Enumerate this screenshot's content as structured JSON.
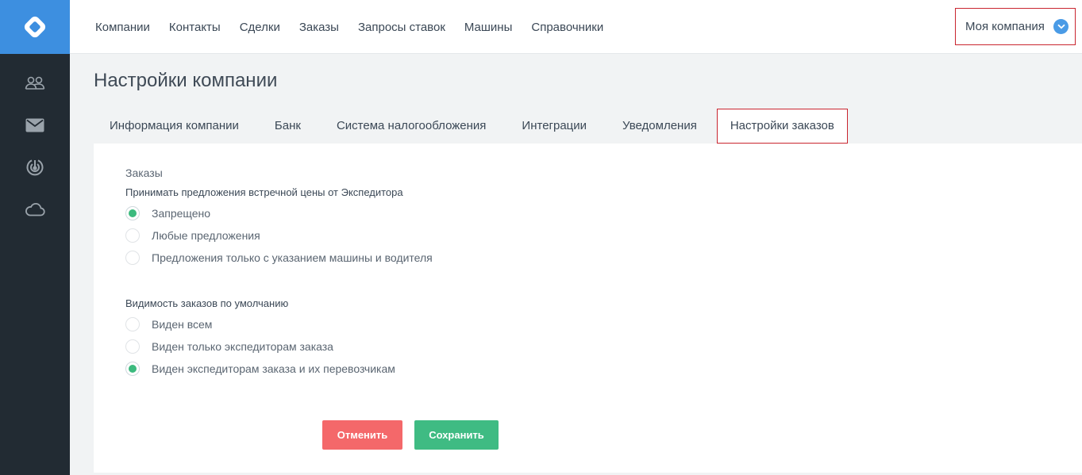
{
  "sidebar": {
    "logo_icon": "diamond-logo",
    "items": [
      {
        "icon": "users-icon"
      },
      {
        "icon": "mail-icon"
      },
      {
        "icon": "radar-icon"
      },
      {
        "icon": "cloud-icon"
      }
    ]
  },
  "nav": {
    "items": [
      "Компании",
      "Контакты",
      "Сделки",
      "Заказы",
      "Запросы ставок",
      "Машины",
      "Справочники"
    ]
  },
  "company_menu": {
    "label": "Моя компания",
    "icon": "chevron-down-icon",
    "accent": "#4a9be6"
  },
  "page": {
    "title": "Настройки компании"
  },
  "tabs": [
    {
      "label": "Информация компании"
    },
    {
      "label": "Банк"
    },
    {
      "label": "Система налогообложения"
    },
    {
      "label": "Интеграции"
    },
    {
      "label": "Уведомления"
    },
    {
      "label": "Настройки заказов",
      "active": true
    }
  ],
  "orders": {
    "section_title": "Заказы",
    "counter_offers": {
      "question": "Принимать предложения встречной цены от Экспедитора",
      "options": [
        {
          "label": "Запрещено",
          "selected": true
        },
        {
          "label": "Любые предложения",
          "selected": false
        },
        {
          "label": "Предложения только с указанием машины и водителя",
          "selected": false
        }
      ]
    },
    "visibility": {
      "question": "Видимость заказов по умолчанию",
      "options": [
        {
          "label": "Виден всем",
          "selected": false
        },
        {
          "label": "Виден только экспедиторам заказа",
          "selected": false
        },
        {
          "label": "Виден экспедиторам заказа и их перевозчикам",
          "selected": true
        }
      ]
    }
  },
  "actions": {
    "cancel_label": "Отменить",
    "save_label": "Сохранить",
    "cancel_color": "#f4686a",
    "save_color": "#3fbb83"
  }
}
